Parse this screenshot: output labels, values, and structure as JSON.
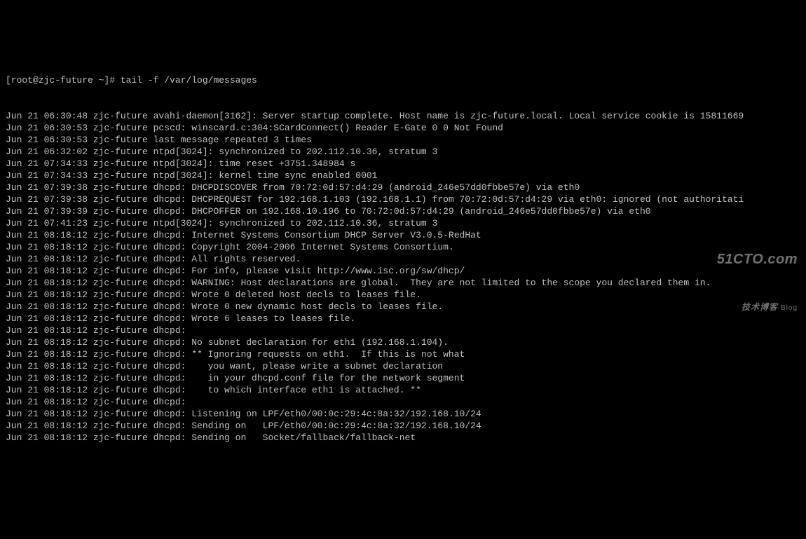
{
  "prompt": "[root@zjc-future ~]# tail -f /var/log/messages",
  "lines": [
    "Jun 21 06:30:48 zjc-future avahi-daemon[3162]: Server startup complete. Host name is zjc-future.local. Local service cookie is 15811669",
    "Jun 21 06:30:53 zjc-future pcscd: winscard.c:304:SCardConnect() Reader E-Gate 0 0 Not Found",
    "Jun 21 06:30:53 zjc-future last message repeated 3 times",
    "Jun 21 06:32:02 zjc-future ntpd[3024]: synchronized to 202.112.10.36, stratum 3",
    "Jun 21 07:34:33 zjc-future ntpd[3024]: time reset +3751.348984 s",
    "Jun 21 07:34:33 zjc-future ntpd[3024]: kernel time sync enabled 0001",
    "Jun 21 07:39:38 zjc-future dhcpd: DHCPDISCOVER from 70:72:0d:57:d4:29 (android_246e57dd0fbbe57e) via eth0",
    "Jun 21 07:39:38 zjc-future dhcpd: DHCPREQUEST for 192.168.1.103 (192.168.1.1) from 70:72:0d:57:d4:29 via eth0: ignored (not authoritati",
    "Jun 21 07:39:39 zjc-future dhcpd: DHCPOFFER on 192.168.10.196 to 70:72:0d:57:d4:29 (android_246e57dd0fbbe57e) via eth0",
    "Jun 21 07:41:23 zjc-future ntpd[3024]: synchronized to 202.112.10.36, stratum 3",
    "Jun 21 08:18:12 zjc-future dhcpd: Internet Systems Consortium DHCP Server V3.0.5-RedHat",
    "Jun 21 08:18:12 zjc-future dhcpd: Copyright 2004-2006 Internet Systems Consortium.",
    "Jun 21 08:18:12 zjc-future dhcpd: All rights reserved.",
    "Jun 21 08:18:12 zjc-future dhcpd: For info, please visit http://www.isc.org/sw/dhcp/",
    "Jun 21 08:18:12 zjc-future dhcpd: WARNING: Host declarations are global.  They are not limited to the scope you declared them in.",
    "Jun 21 08:18:12 zjc-future dhcpd: Wrote 0 deleted host decls to leases file.",
    "Jun 21 08:18:12 zjc-future dhcpd: Wrote 0 new dynamic host decls to leases file.",
    "Jun 21 08:18:12 zjc-future dhcpd: Wrote 6 leases to leases file.",
    "Jun 21 08:18:12 zjc-future dhcpd: ",
    "Jun 21 08:18:12 zjc-future dhcpd: No subnet declaration for eth1 (192.168.1.104).",
    "Jun 21 08:18:12 zjc-future dhcpd: ** Ignoring requests on eth1.  If this is not what",
    "Jun 21 08:18:12 zjc-future dhcpd:    you want, please write a subnet declaration",
    "Jun 21 08:18:12 zjc-future dhcpd:    in your dhcpd.conf file for the network segment",
    "Jun 21 08:18:12 zjc-future dhcpd:    to which interface eth1 is attached. **",
    "Jun 21 08:18:12 zjc-future dhcpd: ",
    "Jun 21 08:18:12 zjc-future dhcpd: Listening on LPF/eth0/00:0c:29:4c:8a:32/192.168.10/24",
    "Jun 21 08:18:12 zjc-future dhcpd: Sending on   LPF/eth0/00:0c:29:4c:8a:32/192.168.10/24",
    "Jun 21 08:18:12 zjc-future dhcpd: Sending on   Socket/fallback/fallback-net"
  ],
  "watermark": {
    "main": "51CTO.com",
    "sub": "技术博客",
    "blog": "Blog"
  }
}
